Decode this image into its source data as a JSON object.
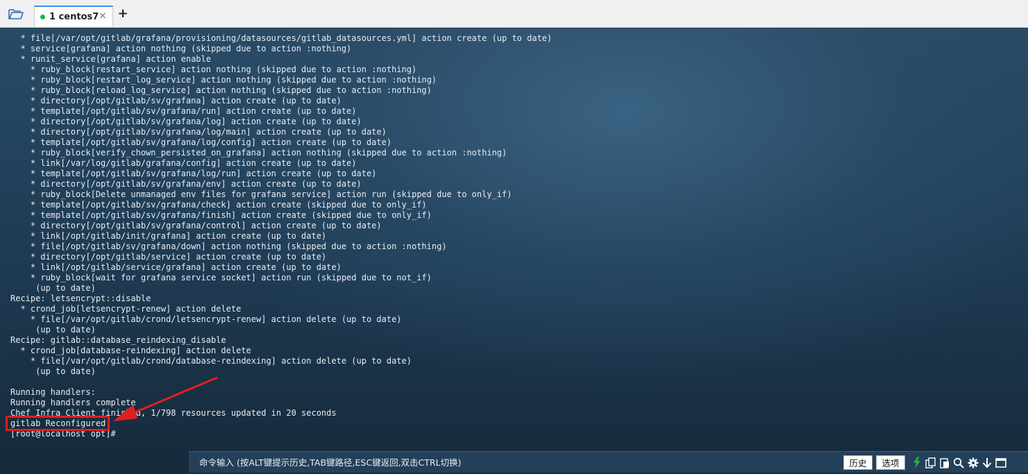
{
  "tab": {
    "label": "1 centos7",
    "close": "×",
    "add": "+"
  },
  "terminal": {
    "lines": [
      "  * file[/var/opt/gitlab/grafana/provisioning/datasources/gitlab_datasources.yml] action create (up to date)",
      "  * service[grafana] action nothing (skipped due to action :nothing)",
      "  * runit_service[grafana] action enable",
      "    * ruby_block[restart_service] action nothing (skipped due to action :nothing)",
      "    * ruby_block[restart_log_service] action nothing (skipped due to action :nothing)",
      "    * ruby_block[reload_log_service] action nothing (skipped due to action :nothing)",
      "    * directory[/opt/gitlab/sv/grafana] action create (up to date)",
      "    * template[/opt/gitlab/sv/grafana/run] action create (up to date)",
      "    * directory[/opt/gitlab/sv/grafana/log] action create (up to date)",
      "    * directory[/opt/gitlab/sv/grafana/log/main] action create (up to date)",
      "    * template[/opt/gitlab/sv/grafana/log/config] action create (up to date)",
      "    * ruby_block[verify_chown_persisted_on_grafana] action nothing (skipped due to action :nothing)",
      "    * link[/var/log/gitlab/grafana/config] action create (up to date)",
      "    * template[/opt/gitlab/sv/grafana/log/run] action create (up to date)",
      "    * directory[/opt/gitlab/sv/grafana/env] action create (up to date)",
      "    * ruby_block[Delete unmanaged env files for grafana service] action run (skipped due to only_if)",
      "    * template[/opt/gitlab/sv/grafana/check] action create (skipped due to only_if)",
      "    * template[/opt/gitlab/sv/grafana/finish] action create (skipped due to only_if)",
      "    * directory[/opt/gitlab/sv/grafana/control] action create (up to date)",
      "    * link[/opt/gitlab/init/grafana] action create (up to date)",
      "    * file[/opt/gitlab/sv/grafana/down] action nothing (skipped due to action :nothing)",
      "    * directory[/opt/gitlab/service] action create (up to date)",
      "    * link[/opt/gitlab/service/grafana] action create (up to date)",
      "    * ruby_block[wait for grafana service socket] action run (skipped due to not_if)",
      "     (up to date)",
      "Recipe: letsencrypt::disable",
      "  * crond_job[letsencrypt-renew] action delete",
      "    * file[/var/opt/gitlab/crond/letsencrypt-renew] action delete (up to date)",
      "     (up to date)",
      "Recipe: gitlab::database_reindexing_disable",
      "  * crond_job[database-reindexing] action delete",
      "    * file[/var/opt/gitlab/crond/database-reindexing] action delete (up to date)",
      "     (up to date)",
      "",
      "Running handlers:",
      "Running handlers complete",
      "Chef Infra Client finished, 1/798 resources updated in 20 seconds",
      "gitlab Reconfigured!",
      "[root@localhost opt]#"
    ]
  },
  "annotation": {
    "color": "#e02020"
  },
  "command_bar": {
    "placeholder": "命令输入 (按ALT键提示历史,TAB键路径,ESC键返回,双击CTRL切换)",
    "history_label": "历史",
    "options_label": "选项"
  },
  "icons": {
    "folder": "folder-open-icon",
    "lightning": "lightning-icon",
    "copy": "copy-icon",
    "paste": "paste-icon",
    "search": "search-icon",
    "settings": "gear-icon",
    "download": "arrow-down-icon",
    "window": "window-icon"
  },
  "colors": {
    "accent": "#3a8ee6",
    "status_dot": "#21b24b",
    "lightning": "#21b24b"
  }
}
